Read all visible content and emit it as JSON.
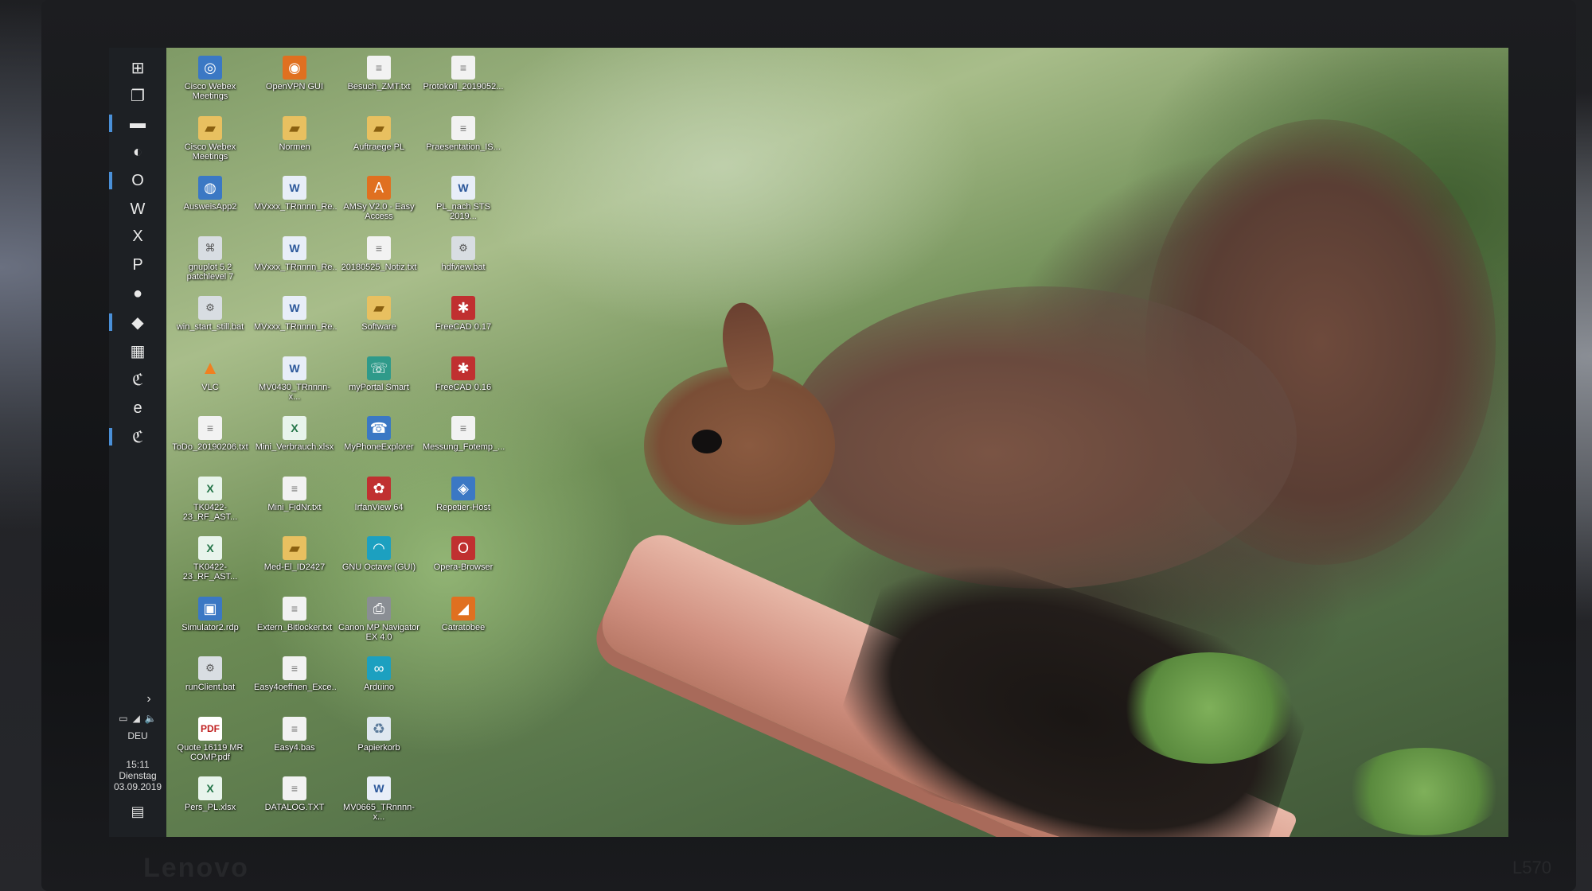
{
  "bezel": {
    "brand": "Lenovo",
    "model": "L570"
  },
  "taskbar": {
    "items": [
      {
        "name": "start-button",
        "glyph": "⊞"
      },
      {
        "name": "task-view-button",
        "glyph": "❐"
      },
      {
        "name": "file-explorer",
        "glyph": "▬"
      },
      {
        "name": "app-icon",
        "glyph": "◐"
      },
      {
        "name": "outlook",
        "glyph": "O"
      },
      {
        "name": "word",
        "glyph": "W"
      },
      {
        "name": "excel",
        "glyph": "X"
      },
      {
        "name": "powerpoint",
        "glyph": "P"
      },
      {
        "name": "firefox",
        "glyph": "●"
      },
      {
        "name": "app-icon-2",
        "glyph": "◆"
      },
      {
        "name": "calculator",
        "glyph": "▦"
      },
      {
        "name": "app-c-1",
        "glyph": "ℭ"
      },
      {
        "name": "internet-explorer",
        "glyph": "e"
      },
      {
        "name": "app-c-2",
        "glyph": "ℭ"
      }
    ],
    "chevron": "›",
    "language": "DEU",
    "time": "15:11",
    "weekday": "Dienstag",
    "date": "03.09.2019"
  },
  "desktop": {
    "icons": [
      {
        "label": "Cisco Webex Meetings",
        "type": "app",
        "g": "◎"
      },
      {
        "label": "OpenVPN GUI",
        "type": "orange",
        "g": "◉"
      },
      {
        "label": "Besuch_ZMT.txt",
        "type": "txt",
        "g": "≡"
      },
      {
        "label": "Protokoll_2019052...",
        "type": "txt",
        "g": "≡"
      },
      {
        "label": "Cisco Webex Meetings",
        "type": "folder",
        "g": "▰"
      },
      {
        "label": "Normen",
        "type": "folder",
        "g": "▰"
      },
      {
        "label": "Auftraege PL",
        "type": "folder",
        "g": "▰"
      },
      {
        "label": "Praesentation_IS...",
        "type": "txt",
        "g": "≡"
      },
      {
        "label": "AusweisApp2",
        "type": "app",
        "g": "◍"
      },
      {
        "label": "MVxxx_TRnnnn_Re...",
        "type": "doc",
        "g": "W"
      },
      {
        "label": "AMSy V2.0 - Easy Access",
        "type": "orange",
        "g": "A"
      },
      {
        "label": "PL_nach STS 2019...",
        "type": "doc",
        "g": "W"
      },
      {
        "label": "gnuplot 5.2 patchlevel 7",
        "type": "bat",
        "g": "⌘"
      },
      {
        "label": "MVxxx_TRnnnn_Re...",
        "type": "doc",
        "g": "W"
      },
      {
        "label": "20180525_Notiz.txt",
        "type": "txt",
        "g": "≡"
      },
      {
        "label": "hdfview.bat",
        "type": "bat",
        "g": "⚙"
      },
      {
        "label": "win_start_still.bat",
        "type": "bat",
        "g": "⚙"
      },
      {
        "label": "MVxxx_TRnnnn_Re...",
        "type": "doc",
        "g": "W"
      },
      {
        "label": "Software",
        "type": "folder",
        "g": "▰"
      },
      {
        "label": "FreeCAD 0.17",
        "type": "red",
        "g": "✱"
      },
      {
        "label": "VLC",
        "type": "vlc",
        "g": "▲"
      },
      {
        "label": "MV0430_TRnnnn-x...",
        "type": "doc",
        "g": "W"
      },
      {
        "label": "myPortal Smart",
        "type": "green",
        "g": "☏"
      },
      {
        "label": "FreeCAD 0.16",
        "type": "red",
        "g": "✱"
      },
      {
        "label": "ToDo_20190206.txt",
        "type": "txt",
        "g": "≡"
      },
      {
        "label": "Mini_Verbrauch.xlsx",
        "type": "xls",
        "g": "X"
      },
      {
        "label": "MyPhoneExplorer",
        "type": "app",
        "g": "☎"
      },
      {
        "label": "Messung_Fotemp_...",
        "type": "txt",
        "g": "≡"
      },
      {
        "label": "TK0422-23_RF_AST...",
        "type": "xls",
        "g": "X"
      },
      {
        "label": "Mini_FidNr.txt",
        "type": "txt",
        "g": "≡"
      },
      {
        "label": "IrfanView 64",
        "type": "red",
        "g": "✿"
      },
      {
        "label": "Repetier-Host",
        "type": "app",
        "g": "◈"
      },
      {
        "label": "TK0422-23_RF_AST...",
        "type": "xls",
        "g": "X"
      },
      {
        "label": "Med-El_ID2427",
        "type": "folder",
        "g": "▰"
      },
      {
        "label": "GNU Octave (GUI)",
        "type": "cyan",
        "g": "◠"
      },
      {
        "label": "Opera-Browser",
        "type": "red",
        "g": "O"
      },
      {
        "label": "Simulator2.rdp",
        "type": "app",
        "g": "▣"
      },
      {
        "label": "Extern_Bitlocker.txt",
        "type": "txt",
        "g": "≡"
      },
      {
        "label": "Canon MP Navigator EX 4.0",
        "type": "printer",
        "g": "⎙"
      },
      {
        "label": "Catratobee",
        "type": "orange",
        "g": "◢"
      },
      {
        "label": "runClient.bat",
        "type": "bat",
        "g": "⚙"
      },
      {
        "label": "Easy4oeffnen_Exce...",
        "type": "txt",
        "g": "≡"
      },
      {
        "label": "Arduino",
        "type": "cyan",
        "g": "∞"
      },
      {
        "label": "",
        "type": "none",
        "g": ""
      },
      {
        "label": "Quote 16119 MR COMP.pdf",
        "type": "pdf",
        "g": "PDF"
      },
      {
        "label": "Easy4.bas",
        "type": "txt",
        "g": "≡"
      },
      {
        "label": "Papierkorb",
        "type": "bin",
        "g": "♻"
      },
      {
        "label": "",
        "type": "none",
        "g": ""
      },
      {
        "label": "Pers_PL.xlsx",
        "type": "xls",
        "g": "X"
      },
      {
        "label": "DATALOG.TXT",
        "type": "txt",
        "g": "≡"
      },
      {
        "label": "MV0665_TRnnnn-x...",
        "type": "doc",
        "g": "W"
      },
      {
        "label": "",
        "type": "none",
        "g": ""
      }
    ]
  }
}
